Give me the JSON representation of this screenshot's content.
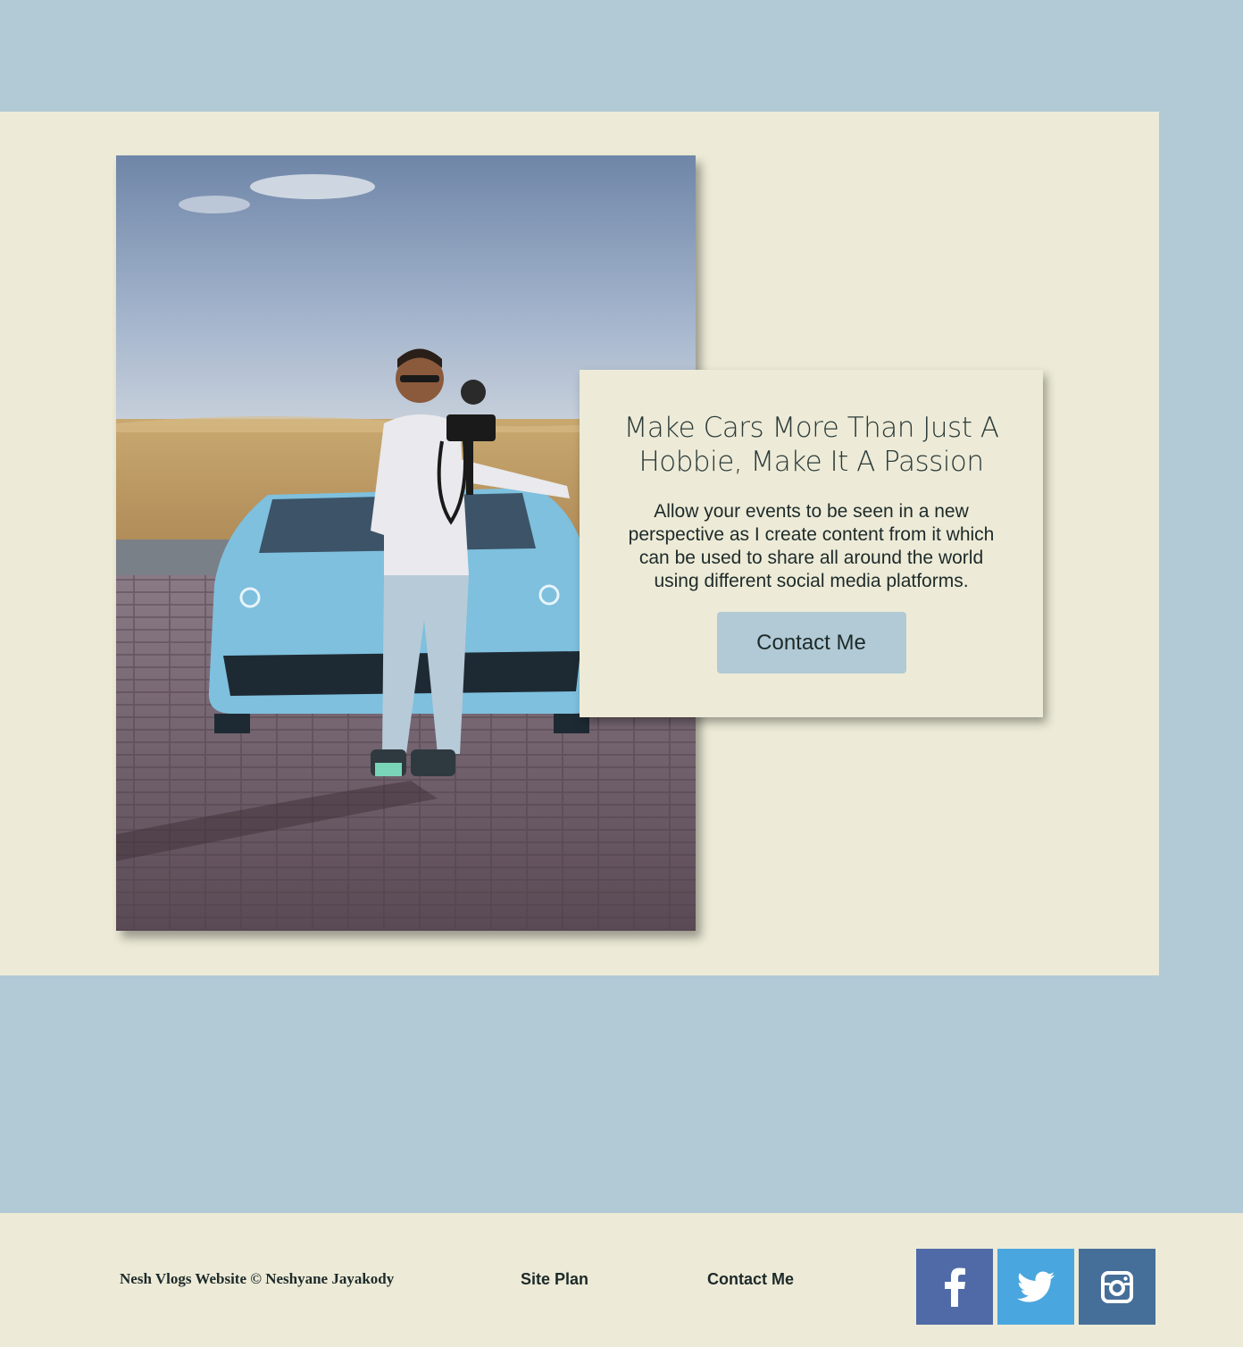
{
  "hero": {
    "image_alt": "Man filming a vlog in front of a light blue sports car in the desert",
    "card": {
      "title": "Make Cars More Than Just A Hobbie, Make It A Passion",
      "text": "Allow your events to be seen in a new perspective as I create content from it which can be used to share all around the world using different social media platforms.",
      "button_label": "Contact Me"
    }
  },
  "footer": {
    "copyright": "Nesh Vlogs Website © Neshyane Jayakody",
    "links": [
      "Site Plan",
      "Contact Me"
    ],
    "social": [
      {
        "name": "facebook-icon",
        "color": "#4f6aa6"
      },
      {
        "name": "twitter-icon",
        "color": "#4aa6de"
      },
      {
        "name": "instagram-icon",
        "color": "#456f98"
      }
    ]
  },
  "colors": {
    "page_bg": "#b1cad5",
    "panel_bg": "#edebd7",
    "text": "#1d2a2a"
  }
}
